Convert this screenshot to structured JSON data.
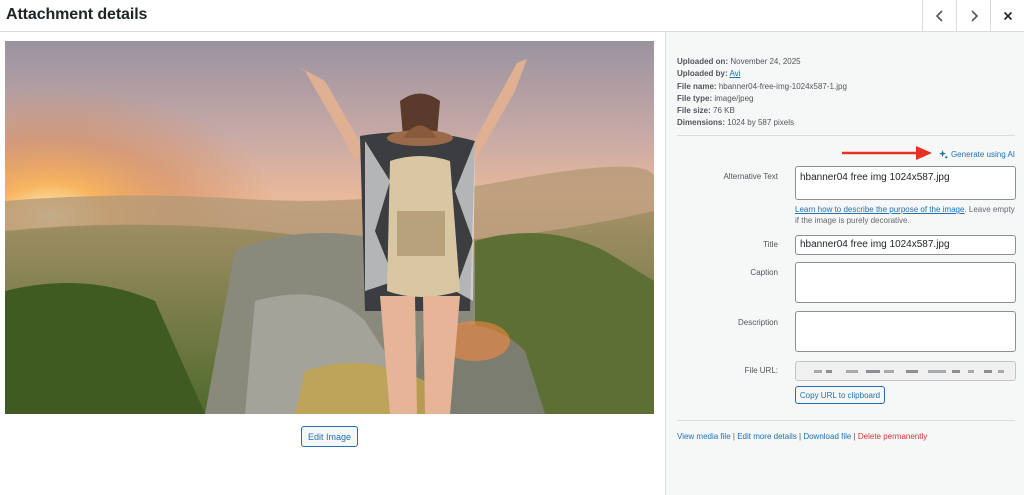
{
  "header": {
    "title": "Attachment details",
    "prev_icon": "chevron-left-icon",
    "next_icon": "chevron-right-icon",
    "close_icon": "close-icon"
  },
  "media": {
    "edit_label": "Edit Image"
  },
  "meta": {
    "uploaded_on_label": "Uploaded on:",
    "uploaded_on": "November 24, 2025",
    "uploaded_by_label": "Uploaded by:",
    "uploaded_by": "Avi",
    "file_name_label": "File name:",
    "file_name": "hbanner04-free-img-1024x587-1.jpg",
    "file_type_label": "File type:",
    "file_type": "image/jpeg",
    "file_size_label": "File size:",
    "file_size": "76 KB",
    "dimensions_label": "Dimensions:",
    "dimensions": "1024 by 587 pixels"
  },
  "ai": {
    "label": "Generate using AI",
    "icon": "sparkle-icon",
    "arrow_color": "#e8321f"
  },
  "fields": {
    "alt_label": "Alternative Text",
    "alt_value": "hbanner04 free img 1024x587.jpg",
    "help_link": "Learn how to describe the purpose of the image",
    "help_rest": ". Leave empty if the image is purely decorative.",
    "title_label": "Title",
    "title_value": "hbanner04 free img 1024x587.jpg",
    "caption_label": "Caption",
    "caption_value": "",
    "description_label": "Description",
    "description_value": "",
    "url_label": "File URL:",
    "copy_label": "Copy URL to clipboard"
  },
  "actions": {
    "view": "View media file",
    "edit_more": "Edit more details",
    "download": "Download file",
    "delete": "Delete permanently",
    "separator": " | "
  },
  "colors": {
    "link": "#2271b1",
    "danger": "#d63638",
    "panel_bg": "#f6f7f7"
  }
}
